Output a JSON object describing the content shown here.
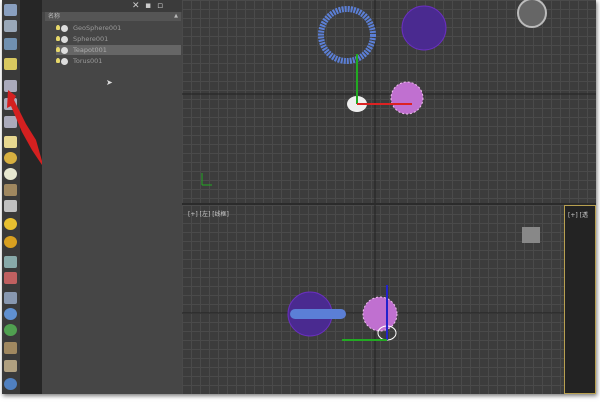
{
  "scene_explorer": {
    "column_header": "名称",
    "items": [
      {
        "label": "GeoSphere001",
        "selected": false
      },
      {
        "label": "Sphere001",
        "selected": false
      },
      {
        "label": "Teapot001",
        "selected": true
      },
      {
        "label": "Torus001",
        "selected": false
      }
    ]
  },
  "viewports": {
    "left_label": "[+] [左] [线框]",
    "perspective_label": "[+] [透"
  },
  "colors": {
    "annotation_arrow": "#d42020",
    "selection_highlight": "#666666",
    "torus": "#5b7fd6",
    "geosphere": "#6a2fc0",
    "sphere": "#c070d0"
  }
}
